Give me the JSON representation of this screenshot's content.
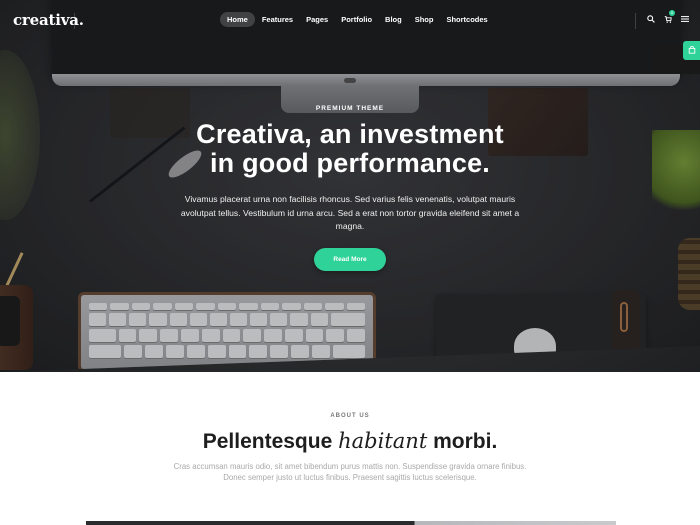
{
  "colors": {
    "accent": "#2fd39a",
    "hero_bg": "#2c2d2f",
    "title": "#1e1e1e",
    "muted": "#a9a9a9"
  },
  "brand": {
    "logo": "creativa."
  },
  "nav": {
    "items": [
      {
        "label": "Home",
        "active": true
      },
      {
        "label": "Features",
        "active": false
      },
      {
        "label": "Pages",
        "active": false
      },
      {
        "label": "Portfolio",
        "active": false
      },
      {
        "label": "Blog",
        "active": false
      },
      {
        "label": "Shop",
        "active": false
      },
      {
        "label": "Shortcodes",
        "active": false
      }
    ],
    "icons": [
      "search-icon",
      "cart-icon",
      "menu-icon"
    ],
    "cart_count": "0",
    "side_tab_icon": "cart-side-tab-icon"
  },
  "hero": {
    "eyebrow": "PREMIUM THEME",
    "headline_line1": "Creativa, an investment",
    "headline_line2": "in good performance.",
    "subtext": "Vivamus placerat urna non facilisis rhoncus. Sed varius felis venenatis, volutpat mauris avolutpat tellus. Vestibulum id urna arcu. Sed a erat non tortor gravida eleifend sit amet a magna.",
    "cta_label": "Read More"
  },
  "about": {
    "label": "ABOUT US",
    "title_part1": "Pellentesque",
    "title_part2": "habitant",
    "title_part3": "morbi.",
    "text": "Cras accumsan mauris odio, sit amet bibendum purus mattis non. Suspendisse gravida ornare finibus. Donec semper justo ut luctus finibus. Praesent sagittis luctus scelerisque."
  }
}
